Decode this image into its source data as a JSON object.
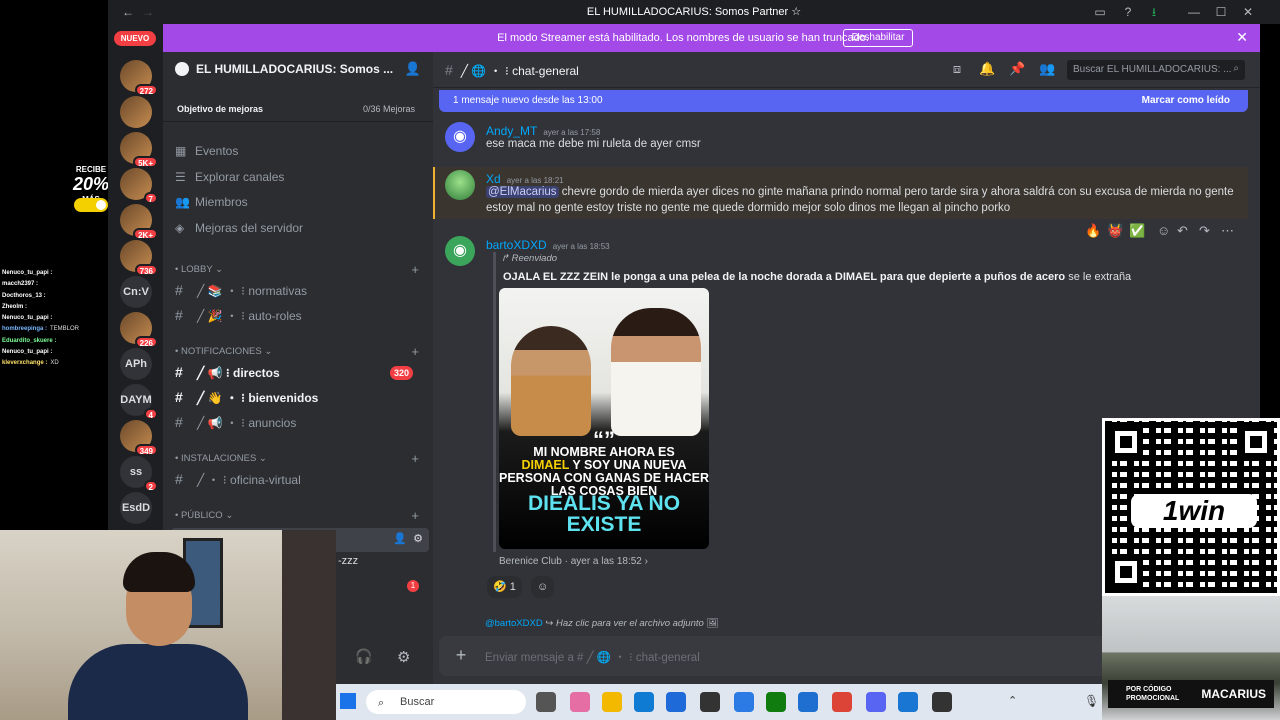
{
  "window": {
    "title": "EL HUMILLADOCARIUS: Somos Partner ☆"
  },
  "streamer_banner": {
    "text": "El modo Streamer está habilitado. Los nombres de usuario se han truncado.",
    "button": "Deshabilitar"
  },
  "rail": {
    "new_pill": "NUEVO",
    "servers": [
      {
        "label": "",
        "badge": "272"
      },
      {
        "label": "",
        "badge": ""
      },
      {
        "label": "",
        "badge": "5K+"
      },
      {
        "label": "",
        "badge": "7"
      },
      {
        "label": "",
        "badge": "2K+"
      },
      {
        "label": "",
        "badge": "736"
      },
      {
        "label": "Cn:V",
        "badge": ""
      },
      {
        "label": "",
        "badge": "226"
      },
      {
        "label": "APh",
        "badge": ""
      },
      {
        "label": "DAYM",
        "badge": "4"
      },
      {
        "label": "",
        "badge": "349"
      },
      {
        "label": "ss",
        "badge": "2"
      },
      {
        "label": "EsdD",
        "badge": ""
      }
    ]
  },
  "overlay_left": {
    "promo_small": "RECIBE",
    "promo_big": "20%",
    "promo_small2": "MÁS",
    "chat": [
      {
        "user": "Nenuco_tu_papi :",
        "msg": "",
        "color": "#ffffff"
      },
      {
        "user": "macch2397 :",
        "msg": "",
        "color": "#ffffff"
      },
      {
        "user": "Docthoros_13 :",
        "msg": "",
        "color": "#ffffff"
      },
      {
        "user": "Zheolm :",
        "msg": "",
        "color": "#ffffff"
      },
      {
        "user": "Nenuco_tu_papi :",
        "msg": "",
        "color": "#ffffff"
      },
      {
        "user": "hombreepinga :",
        "msg": "TEMBLOR",
        "color": "#7ab8ff"
      },
      {
        "user": "Eduardito_skuere :",
        "msg": "",
        "color": "#7dff9a"
      },
      {
        "user": "Nenuco_tu_papi :",
        "msg": "",
        "color": "#ffffff"
      },
      {
        "user": "kleverxchange :",
        "msg": "XD",
        "color": "#ffe06b"
      }
    ]
  },
  "sidebar": {
    "server_name": "EL HUMILLADOCARIUS: Somos ...",
    "boost_label": "Objetivo de mejoras",
    "boost_count": "0/36 Mejoras",
    "nav": [
      {
        "label": "Eventos",
        "icon": "calendar-icon"
      },
      {
        "label": "Explorar canales",
        "icon": "list-icon"
      },
      {
        "label": "Miembros",
        "icon": "members-icon"
      },
      {
        "label": "Mejoras del servidor",
        "icon": "boost-icon"
      }
    ],
    "categories": [
      {
        "label": "LOBBY",
        "channels": [
          {
            "name": "╱ 📚 ・ ⁝ normativas",
            "bold": false,
            "badge": ""
          },
          {
            "name": "╱ 🎉 ・ ⁝ auto-roles",
            "bold": false,
            "badge": ""
          }
        ]
      },
      {
        "label": "NOTIFICACIONES",
        "channels": [
          {
            "name": "╱ 📢 ⁝ directos",
            "bold": true,
            "badge": "320"
          },
          {
            "name": "╱ 👋 ・ ⁝ bienvenidos",
            "bold": true,
            "badge": ""
          },
          {
            "name": "╱ 📢 ・ ⁝ anuncios",
            "bold": false,
            "badge": ""
          }
        ]
      },
      {
        "label": "INSTALACIONES",
        "channels": [
          {
            "name": "╱ ・ ⁝ oficina-virtual",
            "bold": false,
            "badge": ""
          }
        ]
      },
      {
        "label": "PÚBLICO",
        "channels": []
      }
    ],
    "partial_channel": "-zzz",
    "partial_badge": "1"
  },
  "main": {
    "channel_name": "╱ 🌐 ・ ⁝ chat-general",
    "search_placeholder": "Buscar EL HUMILLADOCARIUS: ...",
    "new_messages": "1 mensaje nuevo desde las 13:00",
    "mark_read": "Marcar como leído",
    "messages": [
      {
        "user": "Andy_MT",
        "time": "ayer a las 17:58",
        "text": "ese maca me debe mi ruleta de ayer cmsr",
        "color": "#00a8fc"
      },
      {
        "user": "Xd",
        "time": "ayer a las 18:21",
        "mention": "@ElMacarius",
        "text": " chevre gordo de mierda ayer dices no ginte mañana prindo normal pero tarde sira y ahora saldrá con su excusa de mierda no gente estoy mal no gente estoy triste no gente me quede dormido mejor solo dinos me llegan al pincho porko",
        "color": "#00a8fc"
      },
      {
        "user": "bartoXDXD",
        "time": "ayer a las 18:53",
        "color": "#00a8fc"
      }
    ],
    "forwarded_label": "Reenviado",
    "forwarded_bold": "OJALA EL ZZZ ZEIN  le ponga a una pelea de la noche dorada a DIMAEL para que depierte a puños de acero",
    "forwarded_tail": " se le extraña",
    "image_caption_quote": "“”",
    "image_caption_1": "MI NOMBRE AHORA ES",
    "image_caption_hl": "DIMAEL",
    "image_caption_2": " Y SOY UNA NUEVA PERSONA CON GANAS DE HACER LAS COSAS BIEN",
    "image_caption_3": "DIEALIS YA NO EXISTE",
    "source": "Berenice Club · ayer a las 18:52 ›",
    "reaction_emoji": "🤣",
    "reaction_count": "1",
    "hover_actions": [
      "🔥",
      "👹",
      "✅"
    ],
    "reply_user": "@bartoXDXD",
    "reply_text": "Haz clic para ver el archivo adjunto",
    "composer_placeholder": "Enviar mensaje a # ╱ 🌐 ・ ⁝ chat-general"
  },
  "taskbar": {
    "search": "Buscar"
  },
  "ad": {
    "logo": "1win",
    "promo_label_1": "POR CÓDIGO",
    "promo_label_2": "PROMOCIONAL",
    "promo_code": "MACARIUS"
  }
}
